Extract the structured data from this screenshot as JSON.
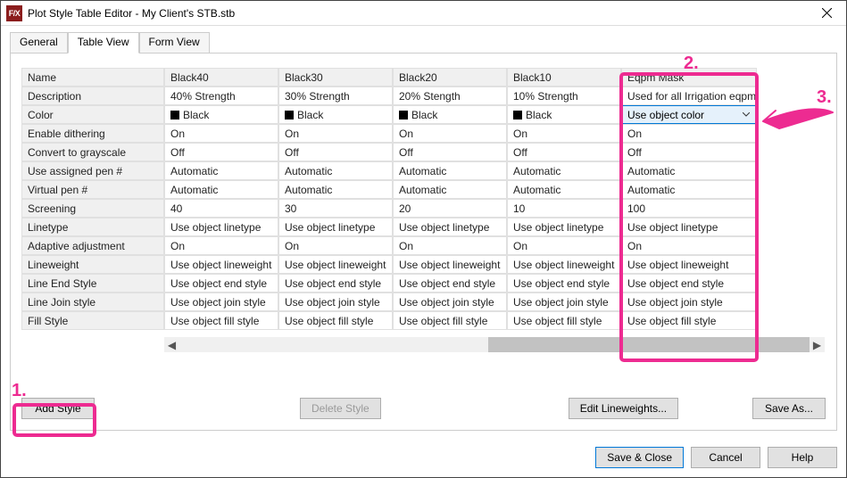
{
  "window": {
    "app_icon_text": "F/X",
    "title": "Plot Style Table Editor - My Client's STB.stb"
  },
  "tabs": {
    "general": "General",
    "table_view": "Table View",
    "form_view": "Form View"
  },
  "row_labels": {
    "name": "Name",
    "description": "Description",
    "color": "Color",
    "dithering": "Enable dithering",
    "grayscale": "Convert to grayscale",
    "assigned_pen": "Use assigned pen #",
    "virtual_pen": "Virtual pen #",
    "screening": "Screening",
    "linetype": "Linetype",
    "adaptive": "Adaptive adjustment",
    "lineweight": "Lineweight",
    "line_end": "Line End Style",
    "line_join": "Line Join style",
    "fill_style": "Fill Style"
  },
  "columns": [
    {
      "name": "Black40",
      "description": "40% Strength",
      "color": "Black",
      "dithering": "On",
      "grayscale": "Off",
      "assigned_pen": "Automatic",
      "virtual_pen": "Automatic",
      "screening": "40",
      "linetype": "Use object linetype",
      "adaptive": "On",
      "lineweight": "Use object lineweight",
      "line_end": "Use object end style",
      "line_join": "Use object join style",
      "fill_style": "Use object fill style"
    },
    {
      "name": "Black30",
      "description": "30% Strength",
      "color": "Black",
      "dithering": "On",
      "grayscale": "Off",
      "assigned_pen": "Automatic",
      "virtual_pen": "Automatic",
      "screening": "30",
      "linetype": "Use object linetype",
      "adaptive": "On",
      "lineweight": "Use object lineweight",
      "line_end": "Use object end style",
      "line_join": "Use object join style",
      "fill_style": "Use object fill style"
    },
    {
      "name": "Black20",
      "description": "20% Stength",
      "color": "Black",
      "dithering": "On",
      "grayscale": "Off",
      "assigned_pen": "Automatic",
      "virtual_pen": "Automatic",
      "screening": "20",
      "linetype": "Use object linetype",
      "adaptive": "On",
      "lineweight": "Use object lineweight",
      "line_end": "Use object end style",
      "line_join": "Use object join style",
      "fill_style": "Use object fill style"
    },
    {
      "name": "Black10",
      "description": "10% Strength",
      "color": "Black",
      "dithering": "On",
      "grayscale": "Off",
      "assigned_pen": "Automatic",
      "virtual_pen": "Automatic",
      "screening": "10",
      "linetype": "Use object linetype",
      "adaptive": "On",
      "lineweight": "Use object lineweight",
      "line_end": "Use object end style",
      "line_join": "Use object join style",
      "fill_style": "Use object fill style"
    },
    {
      "name": "Eqpm Mask",
      "description": "Used for all Irrigation eqpm",
      "color": "Use object color",
      "dithering": "On",
      "grayscale": "Off",
      "assigned_pen": "Automatic",
      "virtual_pen": "Automatic",
      "screening": "100",
      "linetype": "Use object linetype",
      "adaptive": "On",
      "lineweight": "Use object lineweight",
      "line_end": "Use object end style",
      "line_join": "Use object join style",
      "fill_style": "Use object fill style"
    }
  ],
  "buttons": {
    "add_style": "Add Style",
    "delete_style": "Delete Style",
    "edit_lineweights": "Edit Lineweights...",
    "save_as": "Save As..."
  },
  "footer": {
    "save_close": "Save & Close",
    "cancel": "Cancel",
    "help": "Help"
  },
  "annotations": {
    "one": "1.",
    "two": "2.",
    "three": "3."
  },
  "colors": {
    "annotation": "#ed2b91"
  }
}
